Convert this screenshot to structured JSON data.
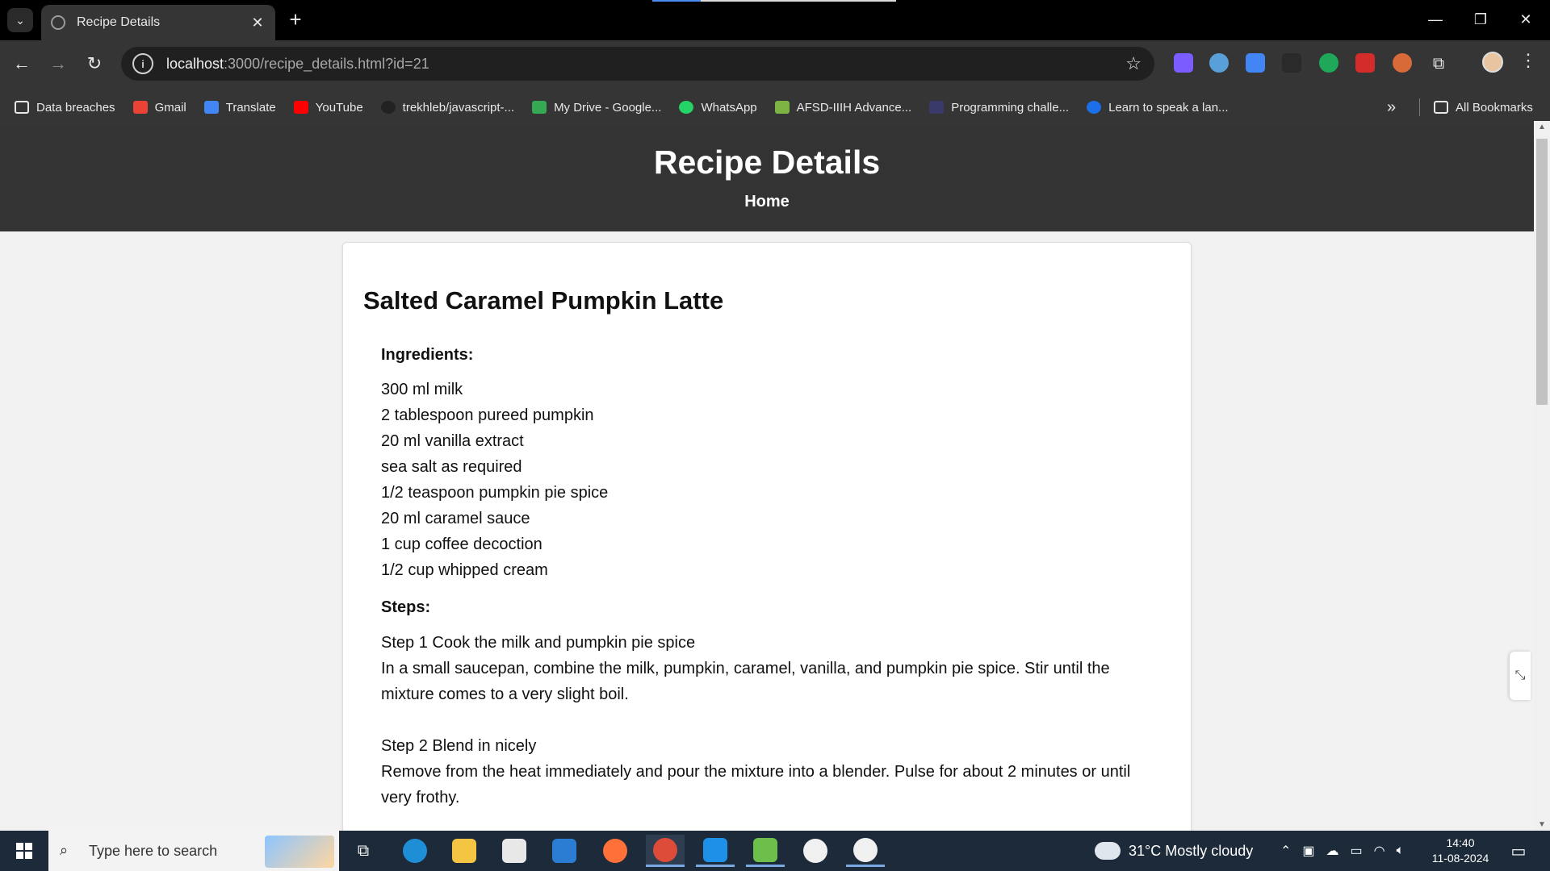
{
  "browser": {
    "tab_title": "Recipe Details",
    "url_host": "localhost",
    "url_rest": ":3000/recipe_details.html?id=21",
    "bookmarks": [
      {
        "label": "Data breaches",
        "icon": "folder-icon",
        "color": "#e8e8e8"
      },
      {
        "label": "Gmail",
        "icon": "gmail-icon",
        "color": "#ea4335"
      },
      {
        "label": "Translate",
        "icon": "translate-icon",
        "color": "#4285f4"
      },
      {
        "label": "YouTube",
        "icon": "youtube-icon",
        "color": "#ff0000"
      },
      {
        "label": "trekhleb/javascript-...",
        "icon": "github-icon",
        "color": "#222222"
      },
      {
        "label": "My Drive - Google...",
        "icon": "drive-icon",
        "color": "#34a853"
      },
      {
        "label": "WhatsApp",
        "icon": "whatsapp-icon",
        "color": "#25d366"
      },
      {
        "label": "AFSD-IIIH Advance...",
        "icon": "feather-icon",
        "color": "#7cb342"
      },
      {
        "label": "Programming challe...",
        "icon": "code-icon",
        "color": "#3a3a6a"
      },
      {
        "label": "Learn to speak a lan...",
        "icon": "duolingo-icon",
        "color": "#1c6fe8"
      }
    ],
    "all_bookmarks": "All Bookmarks"
  },
  "page": {
    "site_title": "Recipe Details",
    "nav_home": "Home",
    "recipe_name": "Salted Caramel Pumpkin Latte",
    "ingredients_title": "Ingredients:",
    "ingredients": [
      "300 ml milk",
      "2 tablespoon pureed pumpkin",
      "20 ml vanilla extract",
      "sea salt as required",
      "1/2 teaspoon pumpkin pie spice",
      "20 ml caramel sauce",
      "1 cup coffee decoction",
      "1/2 cup whipped cream"
    ],
    "steps_title": "Steps:",
    "steps": [
      {
        "title": "Step 1 Cook the milk and pumpkin pie spice",
        "text": "In a small saucepan, combine the milk, pumpkin, caramel, vanilla, and pumpkin pie spice. Stir until the mixture comes to a very slight boil."
      },
      {
        "title": "Step 2 Blend in nicely",
        "text": "Remove from the heat immediately and pour the mixture into a blender. Pulse for about 2 minutes or until very frothy."
      }
    ]
  },
  "taskbar": {
    "search_placeholder": "Type here to search",
    "weather": "31°C  Mostly cloudy",
    "time": "14:40",
    "date": "11-08-2024"
  }
}
